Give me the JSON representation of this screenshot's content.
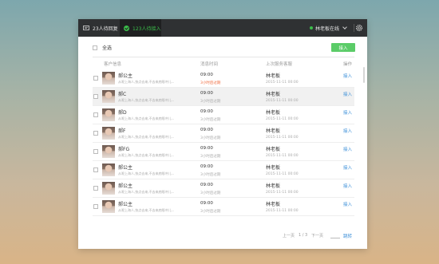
{
  "topbar": {
    "waiting_tab": "23人待回复",
    "active_tab": "123人待接入",
    "agent_status": "林老板在线"
  },
  "toolbar": {
    "select_all": "全选",
    "accept_button": "接入"
  },
  "table": {
    "headers": [
      "客户信息",
      "消息时间",
      "上次服务客服",
      "操作"
    ],
    "rows": [
      {
        "name": "郝公主",
        "message": "从呢上海人,快点去来,不去来底眼冲儿...",
        "time": "09:00",
        "wait": "3小时后过期",
        "wait_urgent": true,
        "agent": "林老板",
        "agent_time": "2015-11-11 00:00",
        "action": "接入",
        "highlighted": false
      },
      {
        "name": "郝C",
        "message": "从呢上海人,快点去来,不去来底眼冲儿...",
        "time": "09:00",
        "wait": "3小时后过期",
        "wait_urgent": false,
        "agent": "林老板",
        "agent_time": "2015-11-11 00:00",
        "action": "接入",
        "highlighted": true
      },
      {
        "name": "郝D",
        "message": "从呢上海人,快点去来,不去来底眼冲儿...",
        "time": "09:00",
        "wait": "3小时后过期",
        "wait_urgent": false,
        "agent": "林老板",
        "agent_time": "2015-11-11 00:00",
        "action": "接入",
        "highlighted": false
      },
      {
        "name": "郝F",
        "message": "从呢上海人,快点去来,不去来底眼冲儿...",
        "time": "09:00",
        "wait": "3小时后过期",
        "wait_urgent": false,
        "agent": "林老板",
        "agent_time": "2015-11-11 00:00",
        "action": "接入",
        "highlighted": false
      },
      {
        "name": "郝FG",
        "message": "从呢上海人,快点去来,不去来底眼冲儿...",
        "time": "09:00",
        "wait": "3小时后过期",
        "wait_urgent": false,
        "agent": "林老板",
        "agent_time": "2015-11-11 00:00",
        "action": "接入",
        "highlighted": false
      },
      {
        "name": "郝公主",
        "message": "从呢上海人,快点去来,不去来底眼冲儿...",
        "time": "09:00",
        "wait": "3小时后过期",
        "wait_urgent": false,
        "agent": "林老板",
        "agent_time": "2015-11-11 00:00",
        "action": "接入",
        "highlighted": false
      },
      {
        "name": "郝公主",
        "message": "从呢上海人,快点去来,不去来底眼冲儿...",
        "time": "09:00",
        "wait": "3小时后过期",
        "wait_urgent": false,
        "agent": "林老板",
        "agent_time": "2015-11-11 00:00",
        "action": "接入",
        "highlighted": false
      },
      {
        "name": "郝公主",
        "message": "从呢上海人,快点去来,不去来底眼冲儿...",
        "time": "09:00",
        "wait": "3小时后过期",
        "wait_urgent": false,
        "agent": "林老板",
        "agent_time": "2015-11-11 00:00",
        "action": "接入",
        "highlighted": false
      }
    ]
  },
  "pagination": {
    "prev": "上一页",
    "page_indicator": "1 / 3",
    "next": "下一页",
    "jump": "跳转"
  },
  "colors": {
    "accent_green": "#5bcc68",
    "link_blue": "#3a8ed8",
    "urgent_orange": "#f06a3c",
    "topbar": "#2f3133"
  }
}
